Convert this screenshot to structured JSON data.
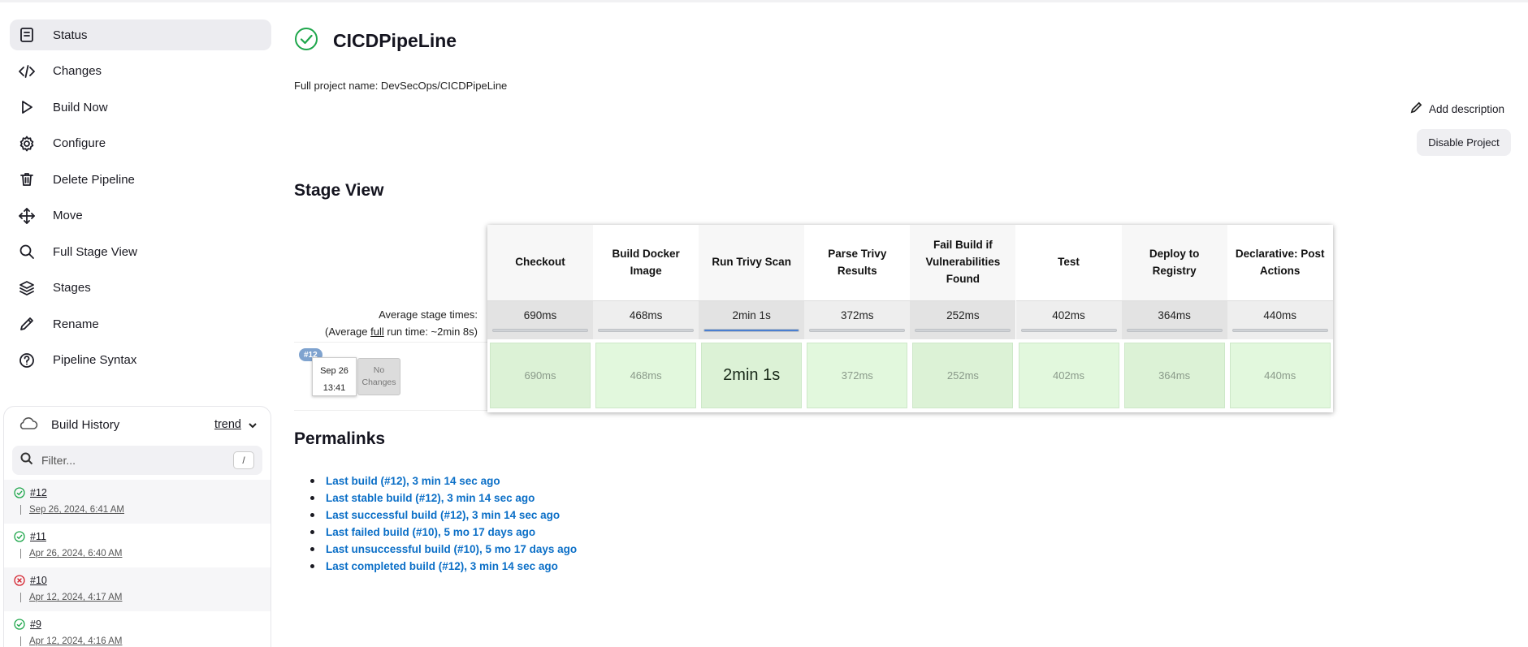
{
  "sidebar": {
    "items": [
      {
        "label": "Status",
        "icon": "status-icon"
      },
      {
        "label": "Changes",
        "icon": "code-icon"
      },
      {
        "label": "Build Now",
        "icon": "play-icon"
      },
      {
        "label": "Configure",
        "icon": "gear-icon"
      },
      {
        "label": "Delete Pipeline",
        "icon": "trash-icon"
      },
      {
        "label": "Move",
        "icon": "move-icon"
      },
      {
        "label": "Full Stage View",
        "icon": "search-icon"
      },
      {
        "label": "Stages",
        "icon": "layers-icon"
      },
      {
        "label": "Rename",
        "icon": "pencil-icon"
      },
      {
        "label": "Pipeline Syntax",
        "icon": "help-icon"
      }
    ]
  },
  "build_history": {
    "title": "Build History",
    "trend_label": "trend",
    "filter_placeholder": "Filter...",
    "shortcut": "/",
    "builds": [
      {
        "number": "#12",
        "date": "Sep 26, 2024, 6:41 AM",
        "status": "success"
      },
      {
        "number": "#11",
        "date": "Apr 26, 2024, 6:40 AM",
        "status": "success"
      },
      {
        "number": "#10",
        "date": "Apr 12, 2024, 4:17 AM",
        "status": "failed"
      },
      {
        "number": "#9",
        "date": "Apr 12, 2024, 4:16 AM",
        "status": "success"
      }
    ]
  },
  "header": {
    "title": "CICDPipeLine",
    "full_name": "Full project name: DevSecOps/CICDPipeLine",
    "add_description": "Add description",
    "disable_project": "Disable Project"
  },
  "stage_view": {
    "title": "Stage View",
    "avg_label_line1": "Average stage times:",
    "avg_label_line2_pre": "(Average ",
    "avg_label_line2_link": "full",
    "avg_label_line2_post": " run time: ~2min 8s)",
    "run": {
      "badge": "#12",
      "date": "Sep 26",
      "time": "13:41",
      "changes": "No Changes"
    },
    "stages": [
      {
        "name": "Checkout",
        "avg": "690ms",
        "progress": 0.0,
        "cell": "690ms"
      },
      {
        "name": "Build Docker Image",
        "avg": "468ms",
        "progress": 0.0,
        "cell": "468ms"
      },
      {
        "name": "Run Trivy Scan",
        "avg": "2min 1s",
        "progress": 1.0,
        "cell": "2min 1s"
      },
      {
        "name": "Parse Trivy Results",
        "avg": "372ms",
        "progress": 0.0,
        "cell": "372ms"
      },
      {
        "name": "Fail Build if Vulnerabilities Found",
        "avg": "252ms",
        "progress": 0.0,
        "cell": "252ms"
      },
      {
        "name": "Test",
        "avg": "402ms",
        "progress": 0.0,
        "cell": "402ms"
      },
      {
        "name": "Deploy to Registry",
        "avg": "364ms",
        "progress": 0.0,
        "cell": "364ms"
      },
      {
        "name": "Declarative: Post Actions",
        "avg": "440ms",
        "progress": 0.0,
        "cell": "440ms"
      }
    ]
  },
  "permalinks": {
    "title": "Permalinks",
    "links": [
      "Last build (#12), 3 min 14 sec ago",
      "Last stable build (#12), 3 min 14 sec ago",
      "Last successful build (#12), 3 min 14 sec ago",
      "Last failed build (#10), 5 mo 17 days ago",
      "Last unsuccessful build (#10), 5 mo 17 days ago",
      "Last completed build (#12), 3 min 14 sec ago"
    ]
  },
  "colors": {
    "success": "#1ea64b",
    "failed": "#d4202c",
    "link": "#0b6fc7",
    "progress": "#4a7fd1",
    "cell_green_a": "#e2f8dd",
    "cell_green_b": "#dcf2d6"
  }
}
